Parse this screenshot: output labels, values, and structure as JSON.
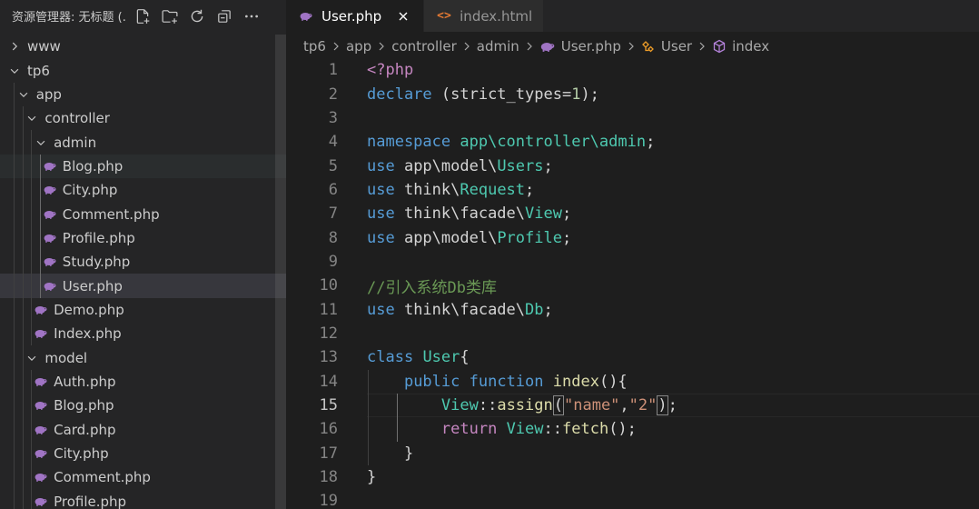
{
  "sidebar": {
    "title": "资源管理器: 无标题 (...",
    "actions": [
      {
        "name": "new-file-icon"
      },
      {
        "name": "new-folder-icon"
      },
      {
        "name": "refresh-icon"
      },
      {
        "name": "collapse-all-icon"
      },
      {
        "name": "more-icon"
      }
    ],
    "tree": [
      {
        "label": "www",
        "type": "folder",
        "expanded": false,
        "depth": 0
      },
      {
        "label": "tp6",
        "type": "folder",
        "expanded": true,
        "depth": 0
      },
      {
        "label": "app",
        "type": "folder",
        "expanded": true,
        "depth": 1
      },
      {
        "label": "controller",
        "type": "folder",
        "expanded": true,
        "depth": 2
      },
      {
        "label": "admin",
        "type": "folder",
        "expanded": true,
        "depth": 3
      },
      {
        "label": "Blog.php",
        "type": "php",
        "depth": 4,
        "state": "hover"
      },
      {
        "label": "City.php",
        "type": "php",
        "depth": 4
      },
      {
        "label": "Comment.php",
        "type": "php",
        "depth": 4
      },
      {
        "label": "Profile.php",
        "type": "php",
        "depth": 4
      },
      {
        "label": "Study.php",
        "type": "php",
        "depth": 4
      },
      {
        "label": "User.php",
        "type": "php",
        "depth": 4,
        "state": "selected"
      },
      {
        "label": "Demo.php",
        "type": "php",
        "depth": 3
      },
      {
        "label": "Index.php",
        "type": "php",
        "depth": 3
      },
      {
        "label": "model",
        "type": "folder",
        "expanded": true,
        "depth": 2
      },
      {
        "label": "Auth.php",
        "type": "php",
        "depth": 3
      },
      {
        "label": "Blog.php",
        "type": "php",
        "depth": 3
      },
      {
        "label": "Card.php",
        "type": "php",
        "depth": 3
      },
      {
        "label": "City.php",
        "type": "php",
        "depth": 3
      },
      {
        "label": "Comment.php",
        "type": "php",
        "depth": 3
      },
      {
        "label": "Profile.php",
        "type": "php",
        "depth": 3
      }
    ]
  },
  "tabs": [
    {
      "label": "User.php",
      "icon": "php-icon",
      "active": true,
      "close": "×"
    },
    {
      "label": "index.html",
      "icon": "html-icon",
      "icon_text": "<>",
      "active": false
    }
  ],
  "breadcrumb": [
    {
      "label": "tp6"
    },
    {
      "label": "app"
    },
    {
      "label": "controller"
    },
    {
      "label": "admin"
    },
    {
      "label": "User.php",
      "icon": "php-icon"
    },
    {
      "label": "User",
      "icon": "class-icon"
    },
    {
      "label": "index",
      "icon": "method-icon"
    }
  ],
  "editor": {
    "current_line": 15,
    "lines": [
      {
        "n": "1",
        "tokens": [
          [
            "ctl",
            "<?php"
          ]
        ]
      },
      {
        "n": "2",
        "tokens": [
          [
            "kw",
            "declare"
          ],
          [
            "plain",
            " (strict_types="
          ],
          [
            "num",
            "1"
          ],
          [
            "plain",
            ");"
          ]
        ]
      },
      {
        "n": "3",
        "tokens": []
      },
      {
        "n": "4",
        "tokens": [
          [
            "kw",
            "namespace"
          ],
          [
            "plain",
            " "
          ],
          [
            "cls",
            "app\\controller\\admin"
          ],
          [
            "plain",
            ";"
          ]
        ]
      },
      {
        "n": "5",
        "tokens": [
          [
            "kw",
            "use"
          ],
          [
            "plain",
            " app\\model\\"
          ],
          [
            "cls",
            "Users"
          ],
          [
            "plain",
            ";"
          ]
        ]
      },
      {
        "n": "6",
        "tokens": [
          [
            "kw",
            "use"
          ],
          [
            "plain",
            " think\\"
          ],
          [
            "cls",
            "Request"
          ],
          [
            "plain",
            ";"
          ]
        ]
      },
      {
        "n": "7",
        "tokens": [
          [
            "kw",
            "use"
          ],
          [
            "plain",
            " think\\facade\\"
          ],
          [
            "cls",
            "View"
          ],
          [
            "plain",
            ";"
          ]
        ]
      },
      {
        "n": "8",
        "tokens": [
          [
            "kw",
            "use"
          ],
          [
            "plain",
            " app\\model\\"
          ],
          [
            "cls",
            "Profile"
          ],
          [
            "plain",
            ";"
          ]
        ]
      },
      {
        "n": "9",
        "tokens": []
      },
      {
        "n": "10",
        "tokens": [
          [
            "cm",
            "//引入系统Db类库"
          ]
        ]
      },
      {
        "n": "11",
        "tokens": [
          [
            "kw",
            "use"
          ],
          [
            "plain",
            " think\\facade\\"
          ],
          [
            "cls",
            "Db"
          ],
          [
            "plain",
            ";"
          ]
        ]
      },
      {
        "n": "12",
        "tokens": []
      },
      {
        "n": "13",
        "tokens": [
          [
            "kw",
            "class"
          ],
          [
            "plain",
            " "
          ],
          [
            "cls",
            "User"
          ],
          [
            "plain",
            "{"
          ]
        ]
      },
      {
        "n": "14",
        "tokens": [
          [
            "plain",
            "    "
          ],
          [
            "kw",
            "public"
          ],
          [
            "plain",
            " "
          ],
          [
            "kw",
            "function"
          ],
          [
            "plain",
            " "
          ],
          [
            "fn",
            "index"
          ],
          [
            "plain",
            "(){"
          ]
        ]
      },
      {
        "n": "15",
        "tokens": [
          [
            "plain",
            "        "
          ],
          [
            "cls",
            "View"
          ],
          [
            "plain",
            "::"
          ],
          [
            "fn",
            "assign"
          ],
          [
            "box",
            "("
          ],
          [
            "str",
            "\"name\""
          ],
          [
            "plain",
            ","
          ],
          [
            "str",
            "\"2\""
          ],
          [
            "box",
            ")"
          ],
          [
            "plain",
            ";"
          ]
        ]
      },
      {
        "n": "16",
        "tokens": [
          [
            "plain",
            "        "
          ],
          [
            "ctl",
            "return"
          ],
          [
            "plain",
            " "
          ],
          [
            "cls",
            "View"
          ],
          [
            "plain",
            "::"
          ],
          [
            "fn",
            "fetch"
          ],
          [
            "plain",
            "();"
          ]
        ]
      },
      {
        "n": "17",
        "tokens": [
          [
            "plain",
            "    }"
          ]
        ]
      },
      {
        "n": "18",
        "tokens": [
          [
            "plain",
            "}"
          ]
        ]
      },
      {
        "n": "19",
        "tokens": []
      }
    ]
  }
}
